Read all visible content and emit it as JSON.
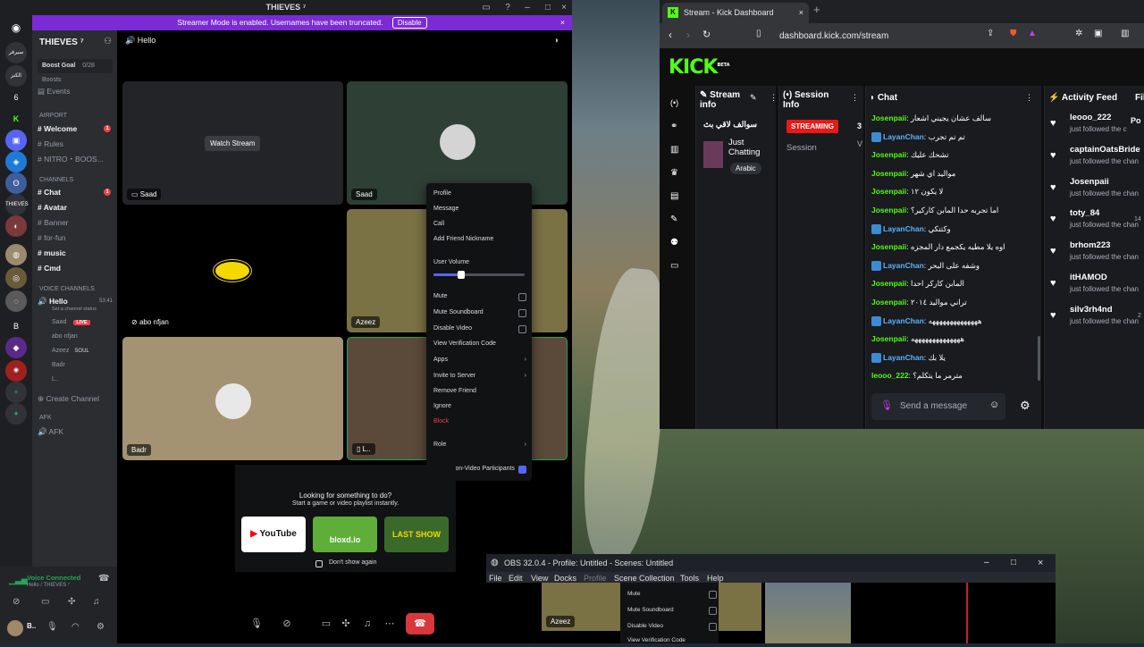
{
  "discord": {
    "title": "THIEVES ⁷",
    "banner": {
      "text": "Streamer Mode is enabled. Usernames have been truncated.",
      "button": "Disable"
    },
    "server_name": "THIEVES ⁷",
    "boost": {
      "goal": "Boost Goal",
      "count": "0/28 Boosts"
    },
    "events": "Events",
    "airport_cat": "Airport",
    "channels_cat": "CHANNELS",
    "voice_cat": "VOICE CHANNELS",
    "afk_cat": "AFK",
    "airport_channels": [
      {
        "name": "Welcome",
        "badge": "1"
      },
      {
        "name": "Rules",
        "badge": ""
      },
      {
        "name": "NITRO・BOOS...",
        "badge": ""
      }
    ],
    "channels": [
      {
        "name": "Chat",
        "badge": "1",
        "bold": true
      },
      {
        "name": "Avatar",
        "badge": "",
        "bold": true
      },
      {
        "name": "Banner",
        "badge": "",
        "bold": false
      },
      {
        "name": "for-fun",
        "badge": "",
        "bold": false
      },
      {
        "name": "music",
        "badge": "",
        "bold": true
      },
      {
        "name": "Cmd",
        "badge": "",
        "bold": true
      }
    ],
    "voice_channel": {
      "name": "Hello",
      "time": "53:41",
      "status": "Set a channel status"
    },
    "voice_users": [
      {
        "name": "Saad",
        "tag": "LIVE"
      },
      {
        "name": "abo nfjan",
        "tag": ""
      },
      {
        "name": "Azeez",
        "tag": "SOUL"
      },
      {
        "name": "Badr",
        "tag": ""
      },
      {
        "name": "L..",
        "tag": ""
      }
    ],
    "create_channel": "Create Channel",
    "afk_channel": "AFK",
    "voice_connected": "Voice Connected",
    "voice_connected_sub": "Hello / THIEVES ⁷",
    "user_short": "B..",
    "call_title": "Hello",
    "tiles": [
      {
        "label": "Saad",
        "button": "Watch Stream"
      },
      {
        "label": "Saad",
        "button": ""
      },
      {
        "label": "abo nfjan",
        "button": ""
      },
      {
        "label": "Azeez",
        "button": ""
      },
      {
        "label": "Badr",
        "button": ""
      },
      {
        "label": "L..",
        "button": ""
      }
    ],
    "context_menu": {
      "items_top": [
        "Profile",
        "Message",
        "Call",
        "Add Friend Nickname"
      ],
      "volume_label": "User Volume",
      "volume_level": 0.3,
      "checks": [
        "Mute",
        "Mute Soundboard",
        "Disable Video"
      ],
      "items_mid": [
        "View Verification Code"
      ],
      "arrows": [
        "Apps",
        "Invite to Server"
      ],
      "items_low": [
        "Remove Friend",
        "Ignore"
      ],
      "danger": "Block",
      "role": "Role",
      "show_nonvideo": "Show Non-Video Participants"
    },
    "activity": {
      "title": "Looking for something to do?",
      "subtitle": "Start a game or video playlist instantly.",
      "cards": [
        "YouTube",
        "bloxd.io",
        "LAST SHOW"
      ],
      "dont_show": "Don't show again"
    }
  },
  "browser": {
    "tab_title": "Stream - Kick Dashboard",
    "url": "dashboard.kick.com/stream",
    "logo": "KICK",
    "logo_beta": "BETA",
    "stream_info": {
      "title": "Stream info",
      "stream_name": "سوالف لاقي بث",
      "category": "Just Chatting",
      "tag": "Arabic"
    },
    "session_info": {
      "title": "Session Info",
      "status": "STREAMING",
      "label": "Session",
      "count": "3",
      "short": "V"
    },
    "chat": {
      "title": "Chat",
      "placeholder": "Send a message",
      "messages": [
        {
          "user": "Josenpaii",
          "text": "سالف عشان يجيني اشعار",
          "color": "green"
        },
        {
          "user": "LayanChan",
          "text": "تم تم تجرب",
          "color": "blue"
        },
        {
          "user": "Josenpaii",
          "text": "تشحك عليك",
          "color": "green"
        },
        {
          "user": "Josenpaii",
          "text": "مواليد اي شهر",
          "color": "green"
        },
        {
          "user": "Josenpaii",
          "text": "لا يكون ١٢",
          "color": "green"
        },
        {
          "user": "Josenpaii",
          "text": "اما تجربه حدا المابن كاركير؟",
          "color": "green"
        },
        {
          "user": "LayanChan",
          "text": "وكتتكي",
          "color": "blue"
        },
        {
          "user": "Josenpaii",
          "text": "اوه يلا مطيه يكجمع دار المجزه",
          "color": "green"
        },
        {
          "user": "LayanChan",
          "text": "وشفه على البحر",
          "color": "blue"
        },
        {
          "user": "Josenpaii",
          "text": "المابن كاركر احدا",
          "color": "green"
        },
        {
          "user": "Josenpaii",
          "text": "تراني مواليد ٢٠١٤",
          "color": "green"
        },
        {
          "user": "LayanChan",
          "text": "ههههههههههههههه",
          "color": "blue"
        },
        {
          "user": "Josenpaii",
          "text": "ههههههههههههههه",
          "color": "green"
        },
        {
          "user": "LayanChan",
          "text": "يلا بك",
          "color": "blue"
        },
        {
          "user": "leooo_222",
          "text": "مترمر ما يتكلم؟",
          "color": "green"
        }
      ]
    },
    "activity_feed": {
      "title": "Activity Feed",
      "extra_title": "Fil",
      "items": [
        {
          "name": "leooo_222",
          "sub": "just followed the c"
        },
        {
          "name": "captainOatsBride",
          "sub": "just followed the chan"
        },
        {
          "name": "Josenpaii",
          "sub": "just followed the chan"
        },
        {
          "name": "toty_84",
          "sub": "just followed the chan"
        },
        {
          "name": "brhom223",
          "sub": "just followed the chan"
        },
        {
          "name": "itHAMOD",
          "sub": "just followed the chan"
        },
        {
          "name": "silv3rh4nd",
          "sub": "just followed the chan"
        }
      ],
      "side": [
        "Po",
        "14",
        "2"
      ]
    }
  },
  "obs": {
    "title": "OBS 32.0.4 - Profile: Untitled - Scenes: Untitled",
    "menu": [
      "File",
      "Edit",
      "View",
      "Docks",
      "Profile",
      "Scene Collection",
      "Tools",
      "Help"
    ],
    "preview_label": "Azeez",
    "menu_items": [
      "Mute",
      "Mute Soundboard",
      "Disable Video",
      "View Verification Code"
    ]
  }
}
